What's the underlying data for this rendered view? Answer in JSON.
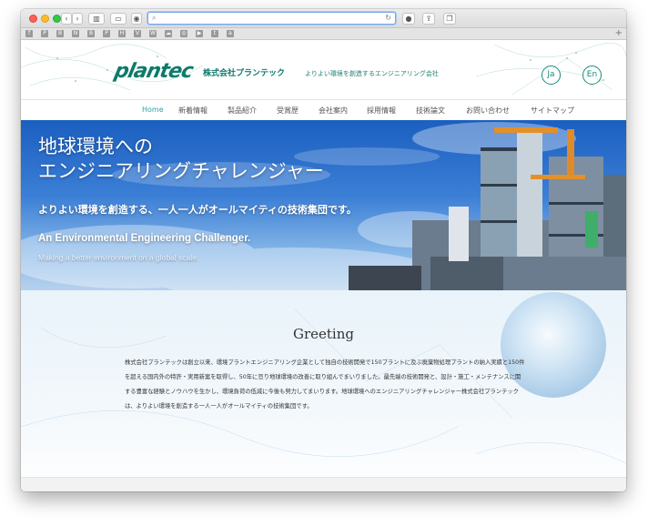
{
  "browser": {
    "address_value": "",
    "bookmark_icons": [
      "f",
      "P",
      "B",
      "N",
      "B",
      "P",
      "H",
      "V",
      "W",
      "☁",
      "◎",
      "▶",
      "t",
      "a"
    ]
  },
  "header": {
    "logo_text": "plantec",
    "logo_jp": "株式会社プランテック",
    "tagline": "よりよい環境を創造するエンジニアリング会社",
    "lang_ja": "Ja",
    "lang_en": "En"
  },
  "nav": {
    "items": [
      "Home",
      "新着情報",
      "製品紹介",
      "受賞歴",
      "会社案内",
      "採用情報",
      "技術論文",
      "お問い合わせ",
      "サイトマップ"
    ]
  },
  "hero": {
    "title_line1": "地球環境への",
    "title_line2": "エンジニアリングチャレンジャー",
    "subtitle": "よりよい環境を創造する、一人一人がオールマイティの技術集団です。",
    "en_title": "An Environmental Engineering Challenger.",
    "en_sub": "Making a better environment on a global scale."
  },
  "greeting": {
    "title": "Greeting",
    "lines": [
      "株式会社プランテックは創立以来、環境プラントエンジニアリング企業として独自の技術開発で150プラントに及ぶ廃棄物処理プラントの納入実績と150件",
      "を超える国内外の特許・実用新案を取得し、50年に亘り地球環境の改善に取り組んでまいりました。最先端の技術開発と、設計・施工・メンテナンスに関",
      "する豊富な経験とノウハウを生かし、環境負荷の低減に今後も努力してまいります。地球環境へのエンジニアリングチャレンジャー株式会社プランテック",
      "は、よりよい環境を創造する一人一人がオールマイティの技術集団です。"
    ]
  },
  "colors": {
    "brand": "#0e7a6a",
    "nav_active": "#2aa3a0",
    "hero_blue": "#1b5fc0"
  }
}
